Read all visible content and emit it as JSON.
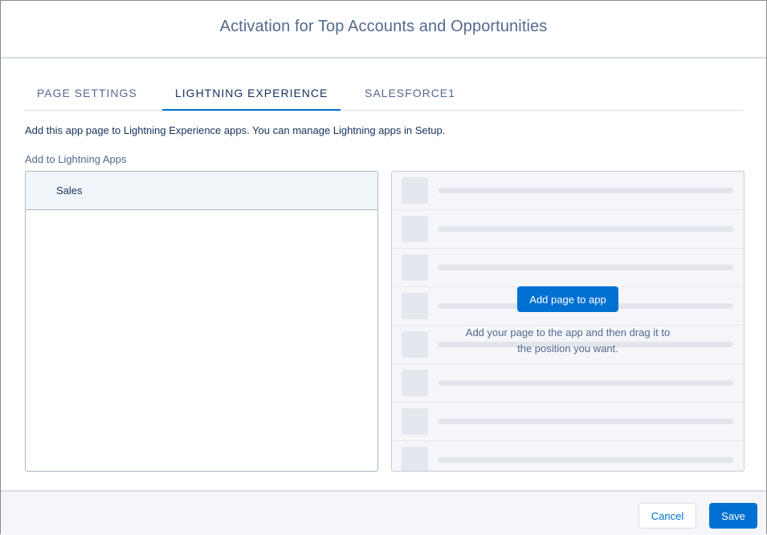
{
  "modal": {
    "title": "Activation for Top Accounts and Opportunities"
  },
  "tabs": [
    {
      "label": "PAGE SETTINGS",
      "active": false
    },
    {
      "label": "LIGHTNING EXPERIENCE",
      "active": true
    },
    {
      "label": "SALESFORCE1",
      "active": false
    }
  ],
  "content": {
    "description": "Add this app page to Lightning Experience apps. You can manage Lightning apps in Setup.",
    "section_label": "Add to Lightning Apps",
    "apps": [
      "Sales"
    ],
    "add_button_label": "Add page to app",
    "hint_line1": "Add your page to the app and then drag it to",
    "hint_line2": "the position you want."
  },
  "footer": {
    "cancel_label": "Cancel",
    "save_label": "Save"
  },
  "colors": {
    "brand_blue": "#0070d2",
    "text_dark": "#16325c",
    "text_muted": "#54698d"
  }
}
